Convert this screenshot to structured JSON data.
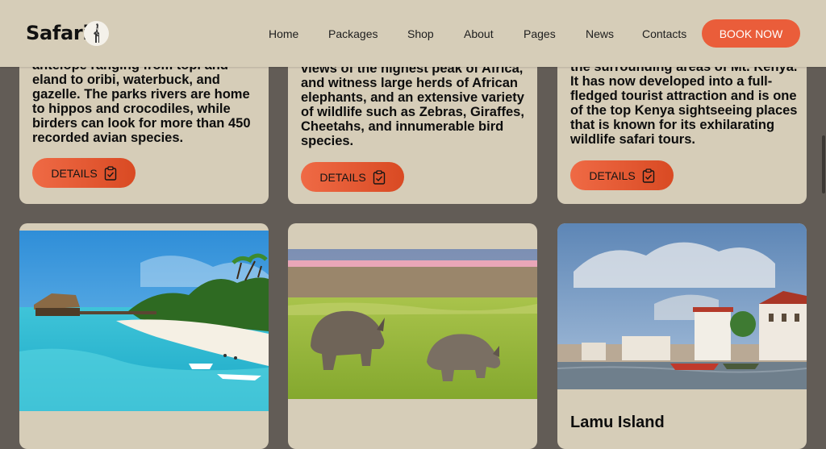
{
  "header": {
    "logo_text": "Safari.",
    "nav": [
      "Home",
      "Packages",
      "Shop",
      "About",
      "Pages",
      "News",
      "Contacts"
    ],
    "book_label": "BOOK NOW"
  },
  "cards_top": [
    {
      "text_lines": "antelope ranging from topi and\neland to oribi, waterbuck, and\ngazelle. The parks rivers are home\nto hippos and crocodiles, while\nbirders can look for more than 450\nrecorded avian species.",
      "details_label": "DETAILS"
    },
    {
      "text_lines": "views of the highest peak of Africa,\nand witness large herds of African\nelephants, and an extensive variety\nof wildlife such as Zebras, Giraffes,\nCheetahs, and innumerable bird\nspecies.",
      "details_label": "DETAILS"
    },
    {
      "text_lines": "the surrounding areas of Mt. Kenya.\nIt has now developed into a full-\nfledged tourist attraction and is one\nof the top Kenya sightseeing places\nthat is known for its exhilarating\nwildlife safari tours.",
      "details_label": "DETAILS"
    }
  ],
  "cards_bottom": [
    {
      "title": ""
    },
    {
      "title": ""
    },
    {
      "title": "Lamu Island"
    }
  ]
}
